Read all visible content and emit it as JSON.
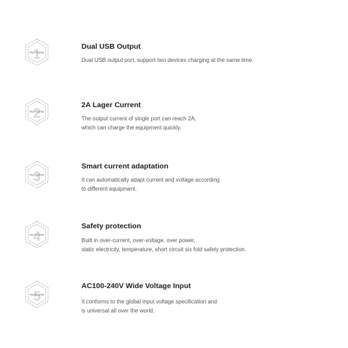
{
  "badge_label": "FEATURE",
  "features": [
    {
      "number": "1",
      "title": "Dual USB Output",
      "lines": [
        "Dual USB output port, support two devices charging at the same time."
      ]
    },
    {
      "number": "2",
      "title": "2A Lager Current",
      "lines": [
        "The output current of single port can reach 2A,",
        "which can charge the equipment quickly."
      ]
    },
    {
      "number": "3",
      "title": "Smart current adaptation",
      "lines": [
        "It can automatically adapt current and voltage according",
        "to different equipment."
      ]
    },
    {
      "number": "4",
      "title": "Safety protection",
      "lines": [
        "Built in over-current, over-voltage, over power,",
        "static electricity, temperature, short circuit six fold safety protection."
      ]
    },
    {
      "number": "5",
      "title": "AC100-240V Wide Voltage Input",
      "lines": [
        "It conforms to the global input voltage specification and",
        "is universal all over the world."
      ]
    }
  ]
}
